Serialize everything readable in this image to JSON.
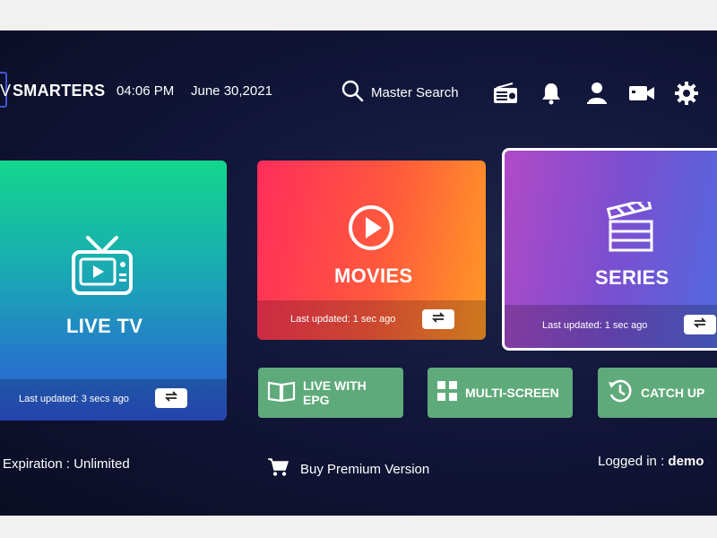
{
  "header": {
    "logo_letter": "V",
    "brand": "SMARTERS",
    "time": "04:06 PM",
    "date": "June 30,2021",
    "search_label": "Master Search",
    "icons": [
      "radio-icon",
      "bell-icon",
      "user-icon",
      "video-camera-icon",
      "gear-icon"
    ]
  },
  "tiles": {
    "live_tv": {
      "title": "LIVE TV",
      "updated": "Last updated: 3 secs ago"
    },
    "movies": {
      "title": "MOVIES",
      "updated": "Last updated: 1 sec ago"
    },
    "series": {
      "title": "SERIES",
      "updated": "Last updated: 1 sec ago"
    }
  },
  "buttons": {
    "live_epg": {
      "line1": "LIVE WITH",
      "line2": "EPG"
    },
    "multi_screen": "MULTI-SCREEN",
    "catch_up": "CATCH UP"
  },
  "footer": {
    "expiration": "Expiration : Unlimited",
    "buy_premium": "Buy Premium Version",
    "logged_in_label": "Logged in :",
    "logged_in_user": "demo"
  },
  "colors": {
    "background": "#0b0d24",
    "green_button": "#5faa7a",
    "accent_blue": "#3f58d6"
  }
}
